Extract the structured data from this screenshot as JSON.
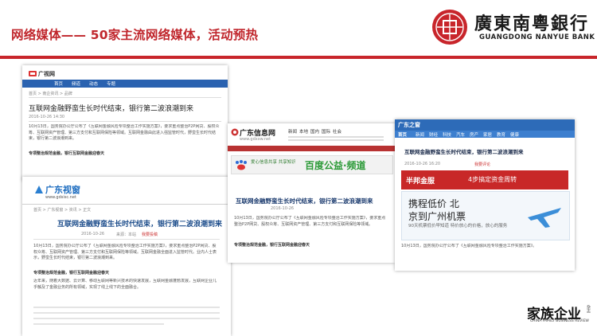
{
  "header": {
    "title": "网络媒体—— 50家主流网络媒体，活动预热",
    "bank_name_cn": "廣東南粵銀行",
    "bank_name_en": "GUANGDONG NANYUE BANK",
    "colors": {
      "accent": "#c8252b",
      "seal": "#c8252b"
    }
  },
  "article_a": {
    "site_name": "广视网",
    "nav": [
      "首页",
      "频道",
      "动态",
      "专题"
    ],
    "breadcrumb": "首页 > 南企资讯 > 品牌",
    "headline": "互联网金融野蛮生长时代结束，银行第二波浪潮到来",
    "date": "2016-10-26 14:30",
    "para1": "10月13日，国务院办公厅公布了《互联网金融风险专项整治工作实施方案》，要求重点整治P2P网贷、股权众筹、互联网资产管理、第三方支付和互联网保险等领域。互联网金融由此进入强监管时代，野蛮生长时代结束，银行第二波浪潮到来。",
    "sub1": "专项整治规范金融，银行互联网金融迎春天"
  },
  "article_b": {
    "site_name": "广东视窗",
    "site_url": "www.gdsisc.net",
    "breadcrumb": "首页 > 广东视窗 > 资讯 > 正文",
    "headline": "互联网金融野蛮生长时代结束，银行第二波浪潮到来",
    "date": "2016-10-26",
    "source": "来源：本站",
    "action": "我要投稿",
    "para1": "10月13日，国务院办公厅公布了《互联网金融风险专项整治工作实施方案》，要求重点整治P2P网贷、股权众筹、互联网资产管理、第三方支付和互联网保险等领域。互联网金融全面进入监管时代。业内人士表示，野蛮生长时代结束，银行第二波浪潮到来。",
    "sub1": "专项整治规范金融，银行互联网金融迎春天",
    "para2": "近年来，随着大数据、云计算、移动互联网等新兴技术的快速发展，互联网金融蓬勃发展，互联网企业几乎触及了金融业务的所有领域，实现了线上线下的全面融合。"
  },
  "article_c": {
    "site_name": "广东信息网",
    "site_url": "www.gdxxw.net",
    "nav": [
      "新闻",
      "本地",
      "国内",
      "国际",
      "社会"
    ],
    "banner_text": "百度公益·频道",
    "banner_sub": "爱心信息共享 共享知识社会",
    "headline": "互联网金融野蛮生长时代结束，银行第二波浪潮到来",
    "date": "2016-10-26",
    "para1": "10月13日，国务院办公厅公布了《互联网金融风险专项整治工作实施方案》，要求重点整治P2P网贷、股权众筹、互联网资产管理、第三方支付和互联网保险等领域。",
    "sub1": "专项整治规范金融，银行互联网金融迎春天"
  },
  "article_d": {
    "site_name": "广东之窗",
    "nav": [
      "首页",
      "新闻",
      "财经",
      "科技",
      "汽车",
      "房产",
      "家居",
      "教育",
      "健康"
    ],
    "headline": "互联网金融野蛮生长时代结束，银行第二波浪潮到来",
    "date": "2016-10-26 16:20",
    "action": "我要评论",
    "ad1_text": "4步搞定资金周转",
    "ad1_brand": "半邦金服",
    "ad2_line1": "携程低价 北",
    "ad2_line2": "京到广州机票",
    "ad2_line3": "90天机票低价早知道 特价放心的价格，放心的服务",
    "para1": "10月13日，国务院办公厅公布了《互联网金融风险专项整治工作实施方案》。"
  },
  "footer": {
    "magazine_cn": "家族企业",
    "magazine_en": "CHINA FAMILY BUSINESS REVIEW",
    "magazine_side": "杂志"
  }
}
